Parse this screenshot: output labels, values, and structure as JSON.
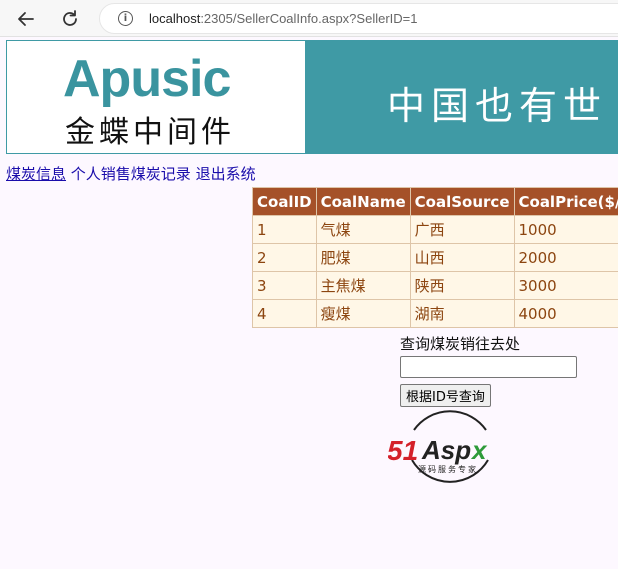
{
  "browser": {
    "url_host": "localhost",
    "url_rest": ":2305/SellerCoalInfo.aspx?SellerID=1"
  },
  "banner": {
    "logo_text": "Apusic",
    "logo_cn": "金蝶中间件",
    "slogan": "中国也有世"
  },
  "nav_links": [
    "煤炭信息",
    "个人销售煤炭记录",
    "退出系统"
  ],
  "table": {
    "headers": [
      "CoalID",
      "CoalName",
      "CoalSource",
      "CoalPrice($/t)"
    ],
    "rows": [
      [
        "1",
        "气煤",
        "广西",
        "1000"
      ],
      [
        "2",
        "肥煤",
        "山西",
        "2000"
      ],
      [
        "3",
        "主焦煤",
        "陕西",
        "3000"
      ],
      [
        "4",
        "瘦煤",
        "湖南",
        "4000"
      ]
    ]
  },
  "query": {
    "label": "查询煤炭销往去处",
    "input_value": "",
    "button_label": "根据ID号查询"
  },
  "seal": {
    "brand": "51Aspx",
    "tagline": "源码服务专家"
  },
  "colors": {
    "header_bg": "#a55129",
    "cell_bg": "#fff7e7",
    "cell_text": "#8c4510",
    "banner_teal": "#3f9aa5"
  }
}
